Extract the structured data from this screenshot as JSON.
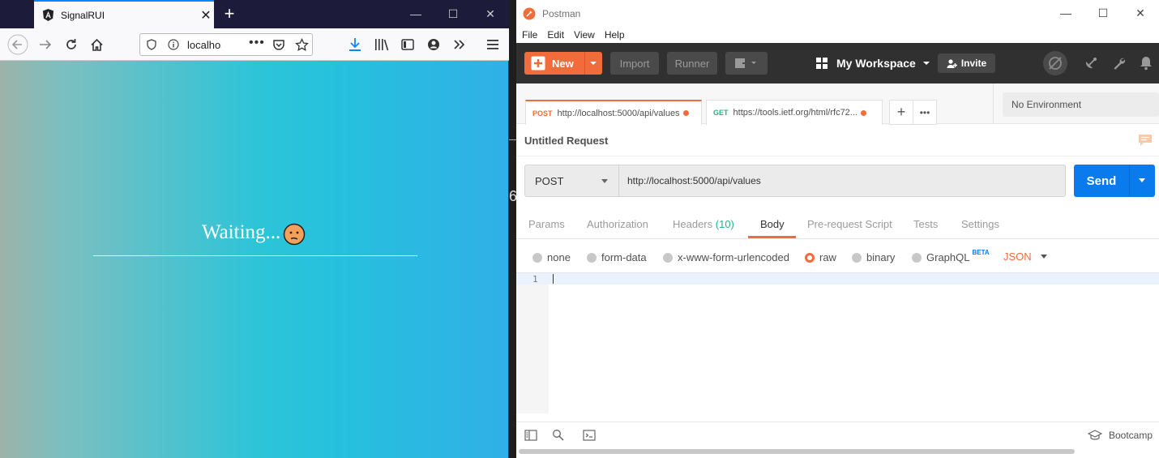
{
  "firefox": {
    "tab_title": "SignalRUI",
    "url": "localhost",
    "page": {
      "waiting_text": "Waiting..."
    }
  },
  "gap_text": "6",
  "postman": {
    "window_title": "Postman",
    "menu": [
      "File",
      "Edit",
      "View",
      "Help"
    ],
    "header": {
      "new_label": "New",
      "import_label": "Import",
      "runner_label": "Runner",
      "workspace_label": "My Workspace",
      "invite_label": "Invite"
    },
    "tabs": [
      {
        "method": "POST",
        "url": "http://localhost:5000/api/values",
        "method_color": "#f26b3a"
      },
      {
        "method": "GET",
        "url": "https://tools.ietf.org/html/rfc72...",
        "method_color": "#26b47f"
      }
    ],
    "environment": "No Environment",
    "request_name": "Untitled Request",
    "request": {
      "method": "POST",
      "url": "http://localhost:5000/api/values",
      "send_label": "Send"
    },
    "subtabs": {
      "params": "Params",
      "authorization": "Authorization",
      "headers": "Headers",
      "headers_count": "(10)",
      "body": "Body",
      "prerequest": "Pre-request Script",
      "tests": "Tests",
      "settings": "Settings"
    },
    "body_options": {
      "none": "none",
      "form_data": "form-data",
      "urlencoded": "x-www-form-urlencoded",
      "raw": "raw",
      "binary": "binary",
      "graphql": "GraphQL",
      "beta": "BETA",
      "format": "JSON"
    },
    "editor": {
      "line_number": "1"
    },
    "footer": {
      "bootcamp_label": "Bootcamp"
    }
  },
  "colors": {
    "accent": "#f26b3a",
    "send_blue": "#097bed",
    "header_dark": "#303030"
  }
}
